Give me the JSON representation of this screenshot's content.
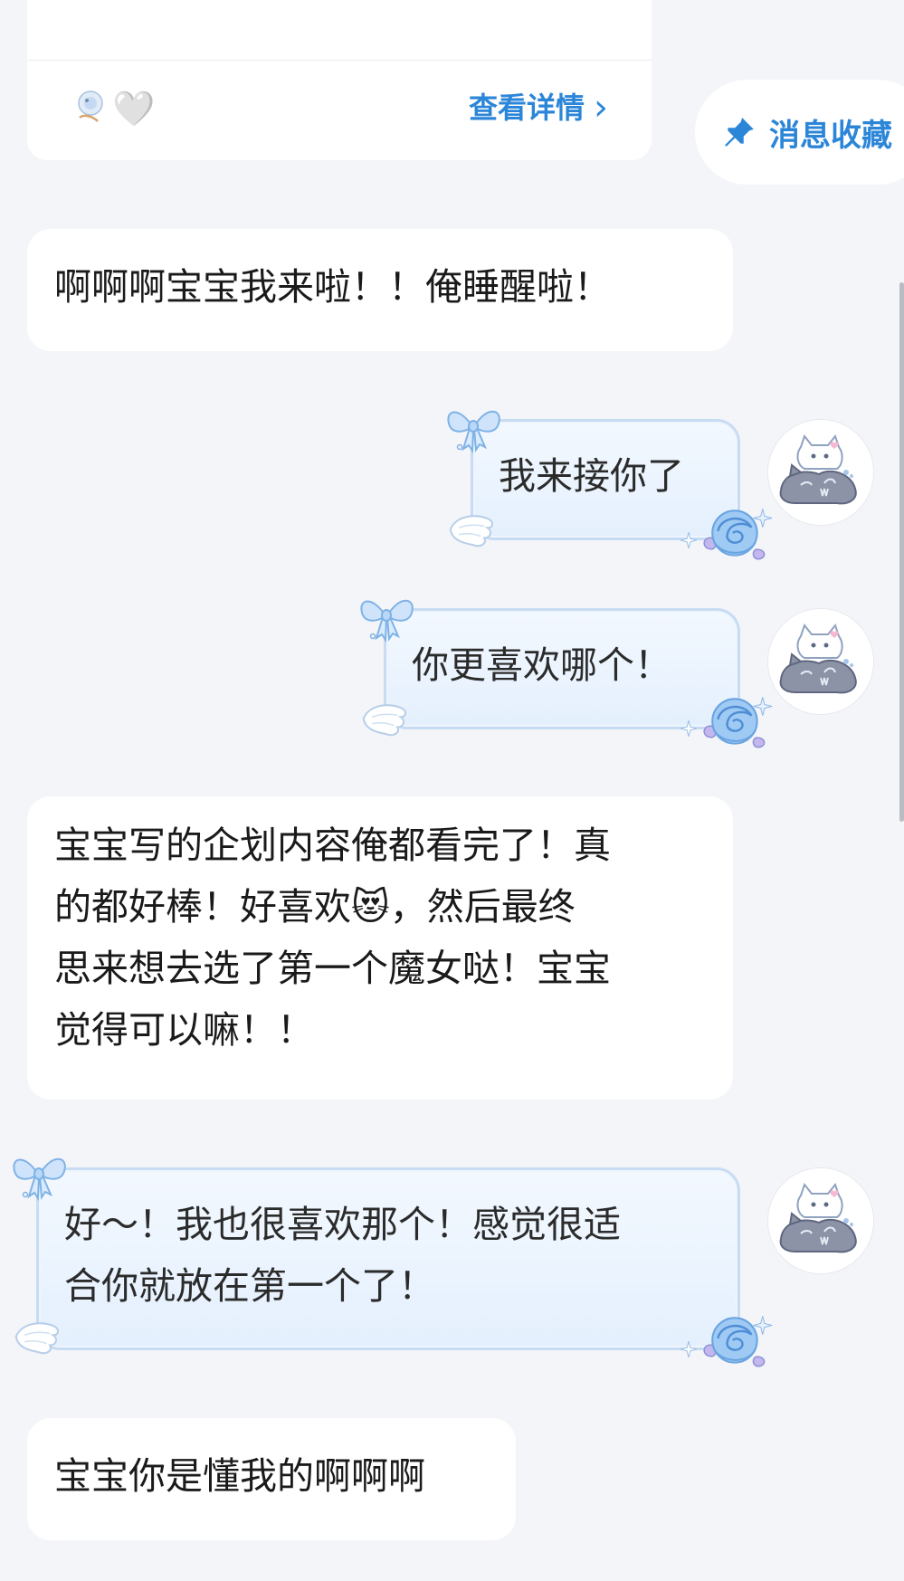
{
  "top_card": {
    "emoji_heart": "🤍",
    "details_label": "查看详情",
    "details_chevron": "›"
  },
  "favorites": {
    "label": "消息收藏",
    "icon": "pin-icon"
  },
  "messages": [
    {
      "side": "received",
      "lines": [
        "啊啊啊宝宝我来啦！！俺睡醒啦！"
      ]
    },
    {
      "side": "sent",
      "lines": [
        "我来接你了"
      ]
    },
    {
      "side": "sent",
      "lines": [
        "你更喜欢哪个！"
      ]
    },
    {
      "side": "received",
      "lines": [
        "宝宝写的企划内容俺都看完了！真",
        "的都好棒！好喜欢😻，然后最终",
        "思来想去选了第一个魔女哒！宝宝",
        "觉得可以嘛！！"
      ]
    },
    {
      "side": "sent",
      "lines": [
        "好～！我也很喜欢那个！感觉很适",
        "合你就放在第一个了！"
      ]
    },
    {
      "side": "received",
      "lines": [
        "宝宝你是懂我的啊啊啊"
      ]
    }
  ],
  "colors": {
    "accent": "#2c86d8",
    "background": "#f4f5f9",
    "sent_bubble": "#e4f0fd",
    "sent_border": "#c7dcf3"
  }
}
